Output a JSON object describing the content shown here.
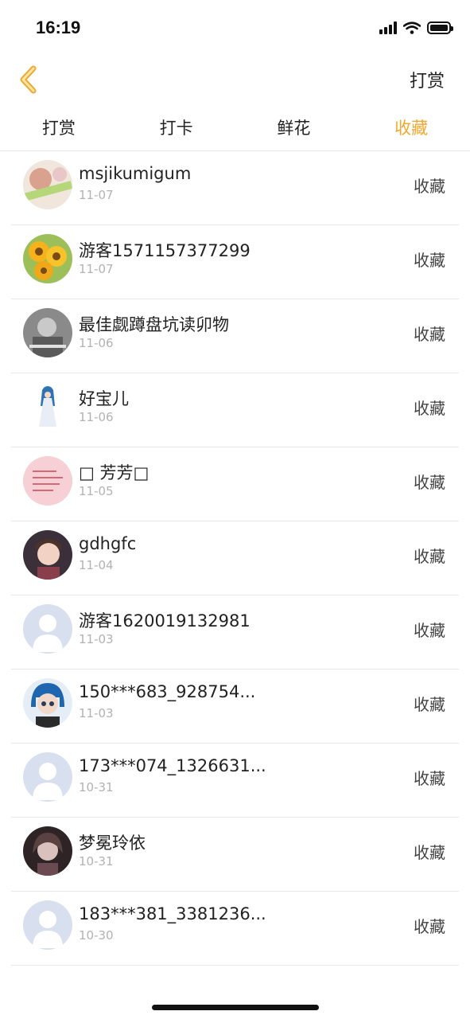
{
  "status_bar": {
    "time": "16:19"
  },
  "nav": {
    "title": "打赏"
  },
  "tabs": [
    {
      "label": "打赏",
      "active": false
    },
    {
      "label": "打卡",
      "active": false
    },
    {
      "label": "鲜花",
      "active": false
    },
    {
      "label": "收藏",
      "active": true
    }
  ],
  "accent_color": "#f0a830",
  "rows": [
    {
      "name": "msjikumigum",
      "date": "11-07",
      "action": "收藏",
      "avatar": "photo-avatar"
    },
    {
      "name": "游客1571157377299",
      "date": "11-07",
      "action": "收藏",
      "avatar": "sunflower-avatar"
    },
    {
      "name": "最佳觑蹲盘坑读卯物",
      "date": "11-06",
      "action": "收藏",
      "avatar": "photo-avatar"
    },
    {
      "name": "好宝儿",
      "date": "11-06",
      "action": "收藏",
      "avatar": "anime-figure-avatar"
    },
    {
      "name": "□ 芳芳□",
      "date": "11-05",
      "action": "收藏",
      "avatar": "pink-text-avatar"
    },
    {
      "name": "gdhgfc",
      "date": "11-04",
      "action": "收藏",
      "avatar": "photo-avatar"
    },
    {
      "name": "游客1620019132981",
      "date": "11-03",
      "action": "收藏",
      "avatar": "default-user-avatar"
    },
    {
      "name": "150***683_928754...",
      "date": "11-03",
      "action": "收藏",
      "avatar": "cartoon-avatar"
    },
    {
      "name": "173***074_1326631...",
      "date": "10-31",
      "action": "收藏",
      "avatar": "default-user-avatar"
    },
    {
      "name": "梦冕玲依",
      "date": "10-31",
      "action": "收藏",
      "avatar": "photo-avatar"
    },
    {
      "name": "183***381_3381236...",
      "date": "10-30",
      "action": "收藏",
      "avatar": "default-user-avatar"
    }
  ]
}
